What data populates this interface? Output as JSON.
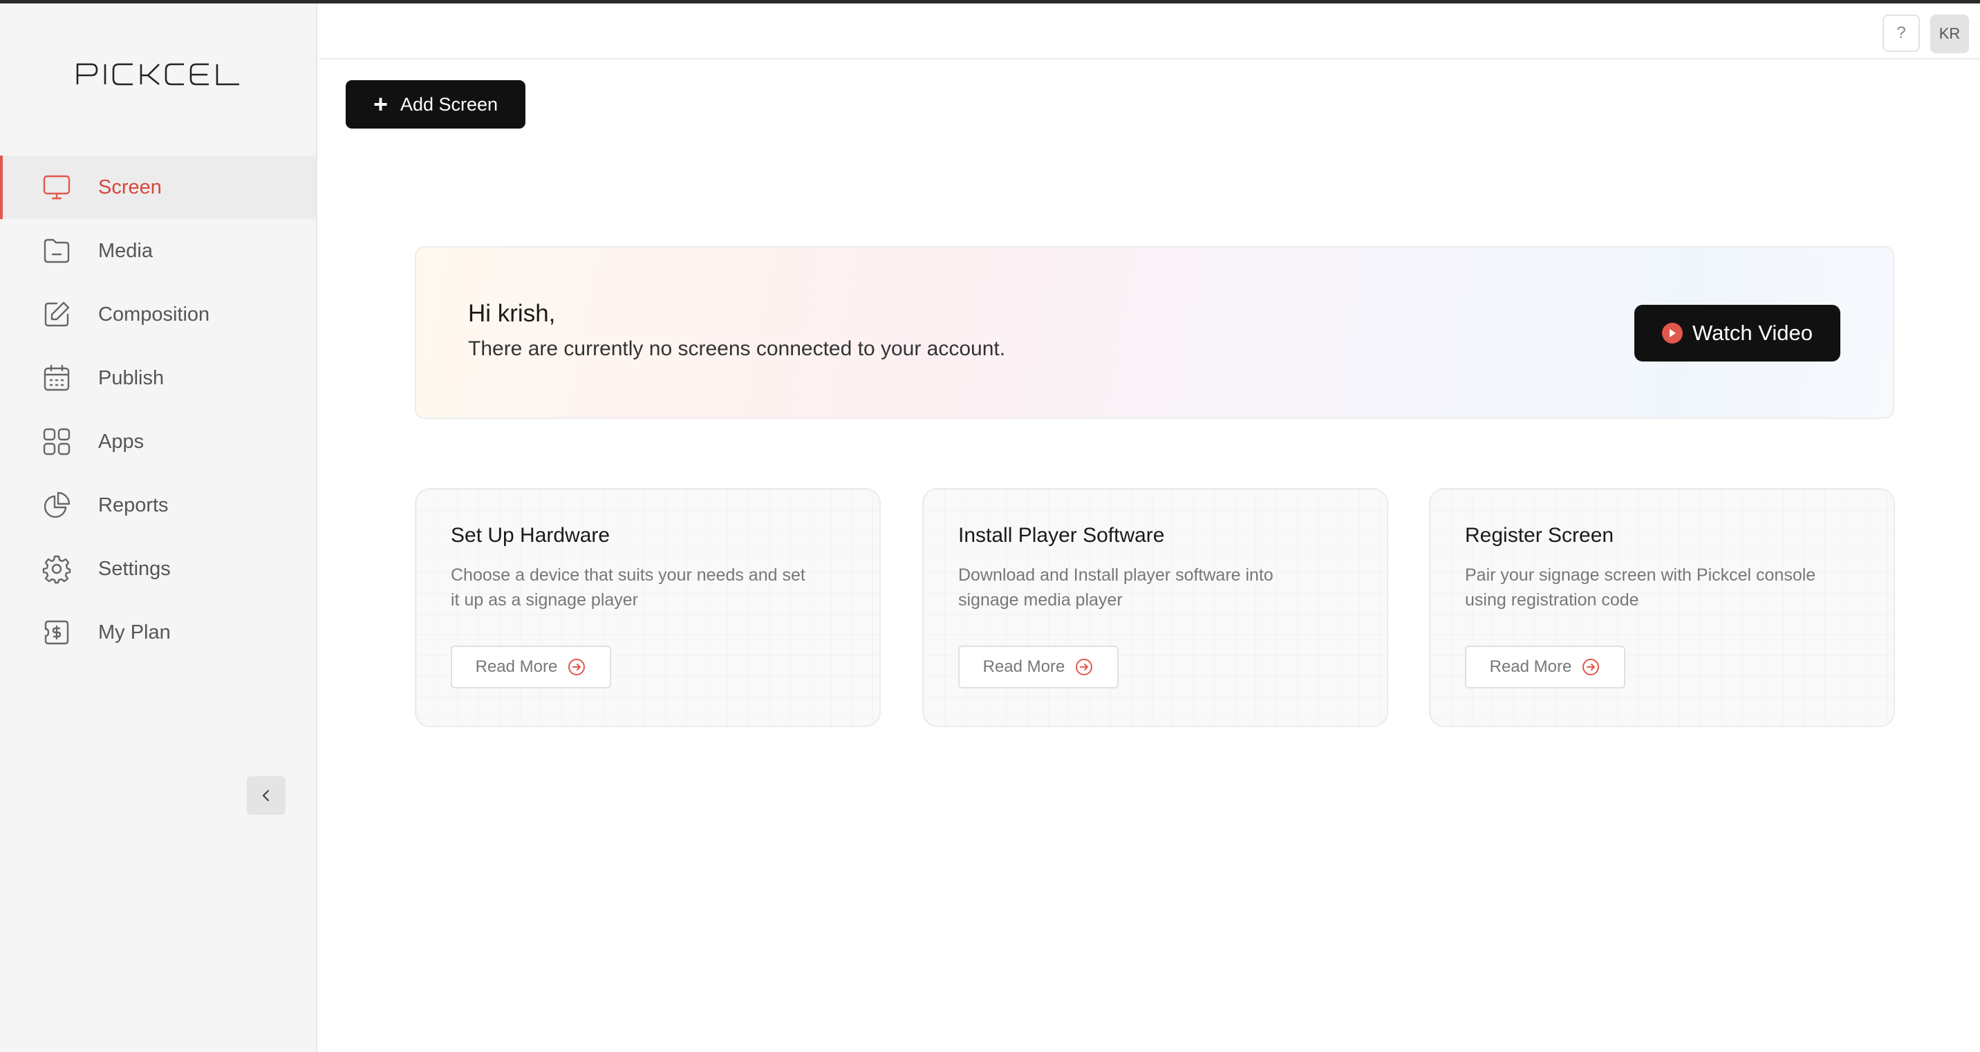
{
  "brand": {
    "logo_text": "PICKCEL",
    "accent": "#e2574c"
  },
  "header": {
    "help_label": "?",
    "avatar_initials": "KR"
  },
  "sidebar": {
    "items": [
      {
        "label": "Screen",
        "icon": "monitor-icon",
        "active": true
      },
      {
        "label": "Media",
        "icon": "folder-icon",
        "active": false
      },
      {
        "label": "Composition",
        "icon": "edit-icon",
        "active": false
      },
      {
        "label": "Publish",
        "icon": "calendar-icon",
        "active": false
      },
      {
        "label": "Apps",
        "icon": "grid-icon",
        "active": false
      },
      {
        "label": "Reports",
        "icon": "pie-chart-icon",
        "active": false
      },
      {
        "label": "Settings",
        "icon": "gear-icon",
        "active": false
      },
      {
        "label": "My Plan",
        "icon": "dollar-icon",
        "active": false
      }
    ],
    "collapse_icon": "chevron-left-icon"
  },
  "main": {
    "add_screen_label": "Add Screen",
    "banner": {
      "greeting": "Hi krish,",
      "message": "There are currently no screens connected to your account.",
      "watch_label": "Watch Video"
    },
    "cards": [
      {
        "title": "Set Up Hardware",
        "description": "Choose a device that suits your needs and set it up as a signage player",
        "button": "Read More"
      },
      {
        "title": "Install Player Software",
        "description": "Download and Install player software into signage media player",
        "button": "Read More"
      },
      {
        "title": "Register Screen",
        "description": "Pair your signage screen with Pickcel console using registration code",
        "button": "Read More"
      }
    ]
  }
}
